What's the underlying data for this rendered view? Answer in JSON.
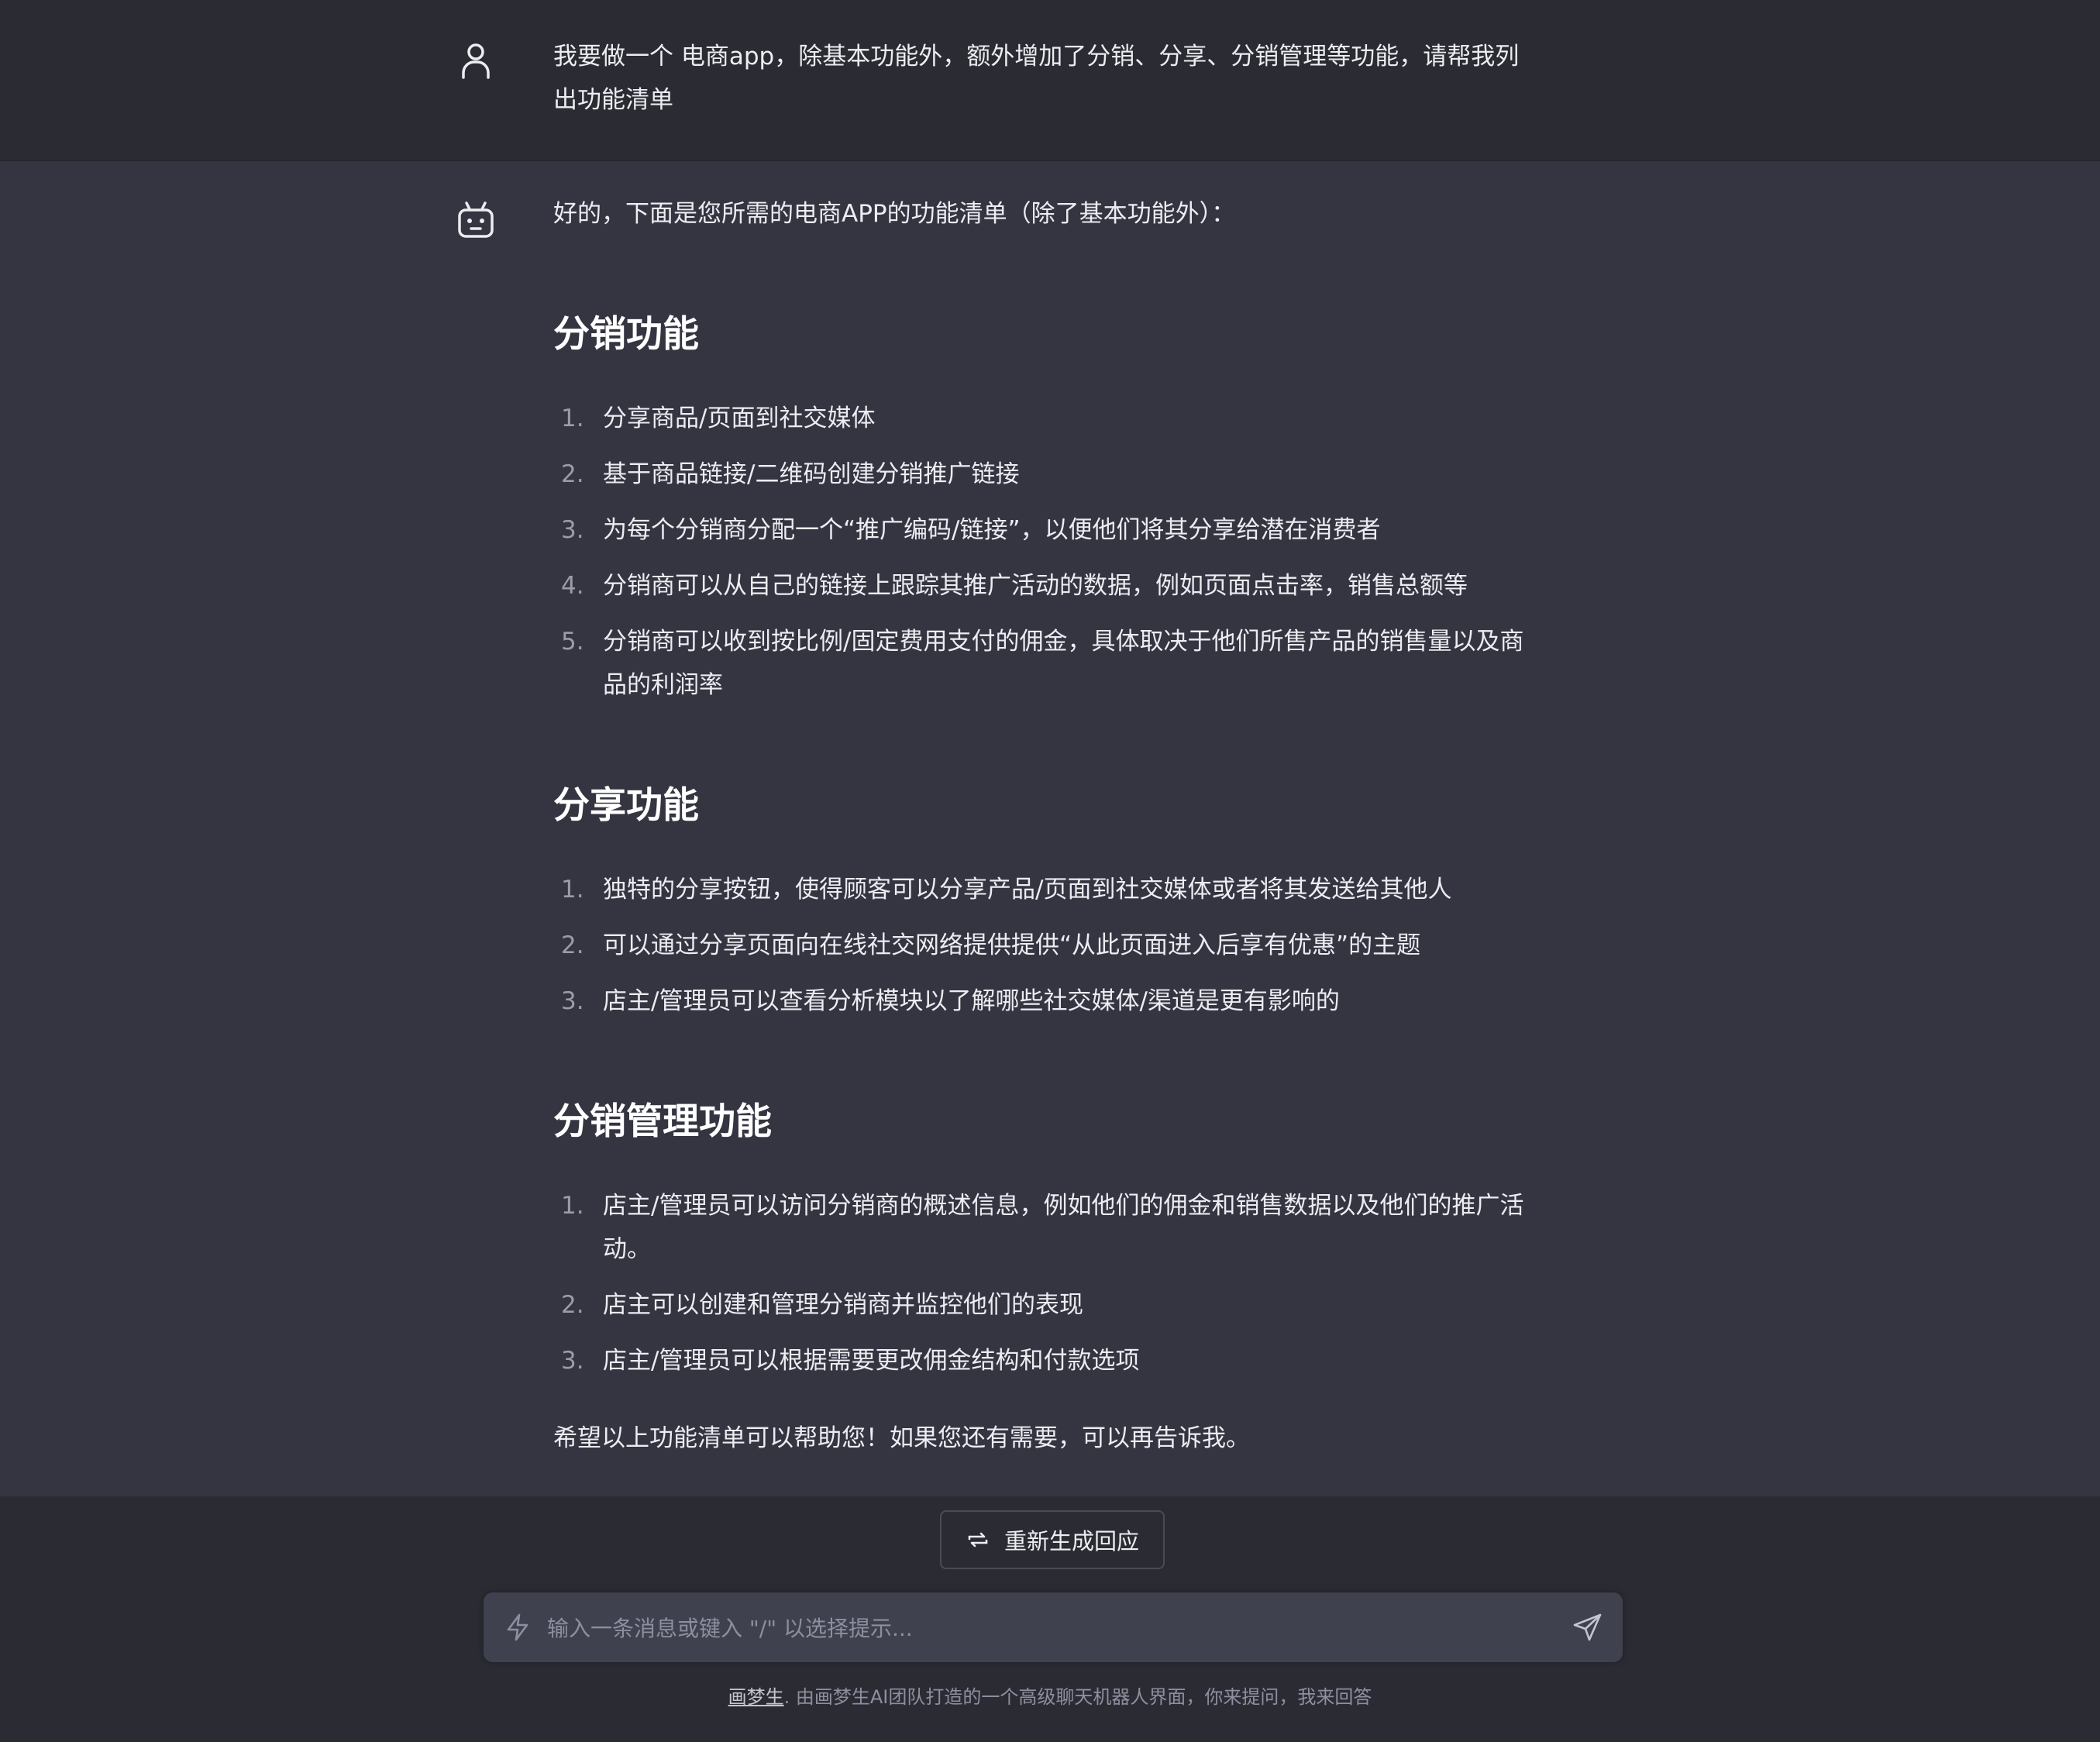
{
  "user_message": {
    "lines": [
      "我要做一个 电商app，除基本功能外，额外增加了分销、分享、分销管理等功能，请帮我列",
      "出功能清单"
    ]
  },
  "bot_message": {
    "intro": "好的，下面是您所需的电商APP的功能清单（除了基本功能外）：",
    "sections": [
      {
        "title": "分销功能",
        "items": [
          {
            "num": "1.",
            "lines": [
              "分享商品/页面到社交媒体"
            ]
          },
          {
            "num": "2.",
            "lines": [
              "基于商品链接/二维码创建分销推广链接"
            ]
          },
          {
            "num": "3.",
            "lines": [
              "为每个分销商分配一个“推广编码/链接”，以便他们将其分享给潜在消费者"
            ]
          },
          {
            "num": "4.",
            "lines": [
              "分销商可以从自己的链接上跟踪其推广活动的数据，例如页面点击率，销售总额等"
            ]
          },
          {
            "num": "5.",
            "lines": [
              "分销商可以收到按比例/固定费用支付的佣金，具体取决于他们所售产品的销售量以及商",
              "品的利润率"
            ]
          }
        ]
      },
      {
        "title": "分享功能",
        "items": [
          {
            "num": "1.",
            "lines": [
              "独特的分享按钮，使得顾客可以分享产品/页面到社交媒体或者将其发送给其他人"
            ]
          },
          {
            "num": "2.",
            "lines": [
              "可以通过分享页面向在线社交网络提供提供“从此页面进入后享有优惠”的主题"
            ]
          },
          {
            "num": "3.",
            "lines": [
              "店主/管理员可以查看分析模块以了解哪些社交媒体/渠道是更有影响的"
            ]
          }
        ]
      },
      {
        "title": "分销管理功能",
        "items": [
          {
            "num": "1.",
            "lines": [
              "店主/管理员可以访问分销商的概述信息，例如他们的佣金和销售数据以及他们的推广活",
              "动。"
            ]
          },
          {
            "num": "2.",
            "lines": [
              "店主可以创建和管理分销商并监控他们的表现"
            ]
          },
          {
            "num": "3.",
            "lines": [
              "店主/管理员可以根据需要更改佣金结构和付款选项"
            ]
          }
        ]
      }
    ],
    "closing": "希望以上功能清单可以帮助您！如果您还有需要，可以再告诉我。"
  },
  "regenerate_button": {
    "label": "重新生成回应",
    "icon": "refresh-icon"
  },
  "input": {
    "placeholder": "输入一条消息或键入 \"/\" 以选择提示...",
    "value": "",
    "left_icon": "bolt-icon",
    "send_icon": "send-icon"
  },
  "footer": {
    "brand": "画梦生",
    "text": ". 由画梦生AI团队打造的一个高级聊天机器人界面，你来提问，我来回答"
  },
  "colors": {
    "background": "#343541",
    "user_message_background": "#2b2c33",
    "input_background": "#40414f",
    "text": "#ececf1",
    "muted": "#8e8ea0"
  }
}
